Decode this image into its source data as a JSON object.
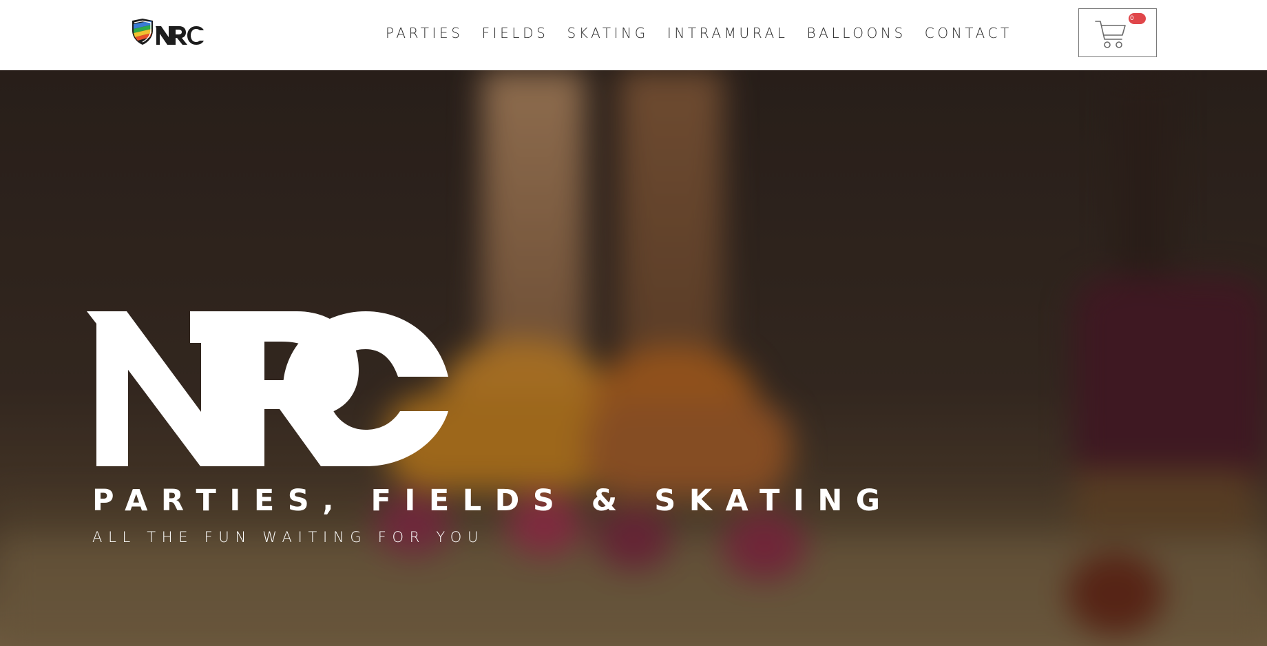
{
  "brand": {
    "name": "NRC"
  },
  "nav": {
    "items": [
      {
        "label": "PARTIES"
      },
      {
        "label": "FIELDS"
      },
      {
        "label": "SKATING"
      },
      {
        "label": "INTRAMURAL"
      },
      {
        "label": "BALLOONS"
      },
      {
        "label": "CONTACT"
      }
    ]
  },
  "cart": {
    "icon": "shopping-cart-icon",
    "count": "0",
    "badge_color": "#e0464a"
  },
  "hero": {
    "logo_text": "NRC",
    "title": "PARTIES, FIELDS & SKATING",
    "subtitle": "ALL THE FUN WAITING FOR YOU",
    "background": "blurred photo of roller skates"
  },
  "colors": {
    "nav_text": "#2a2a2a",
    "hero_text": "#ffffff",
    "hero_dark": "#2b221d"
  }
}
